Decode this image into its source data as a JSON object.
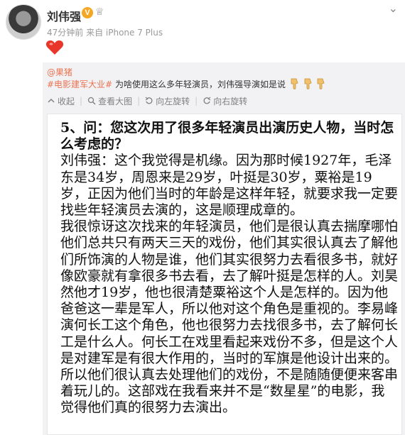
{
  "post": {
    "author": "刘伟强",
    "verified_badge": "V",
    "meta": "47分钟前 来自 iPhone 7 Plus",
    "more_icon": "chevron-down-icon",
    "reaction_icon": "heart-icon"
  },
  "repost": {
    "orig_author": "@果猪",
    "tag": "#电影建军大业#",
    "text": "为啥使用这么多年轻演员，刘伟强导演如是说",
    "toolbar": {
      "collapse": "收起",
      "view_large": "查看大图",
      "rotate_left": "向左旋转",
      "rotate_right": "向右旋转"
    }
  },
  "image": {
    "question": "5、问：您这次用了很多年轻演员出演历史人物，当时怎么考虑的？",
    "paragraphs": [
      "刘伟强：这个我觉得是机缘。因为那时候1927年，毛泽东是34岁，周恩来是29岁，叶挺是30岁，粟裕是19岁，正因为他们当时的年龄是这样年轻，就要求我一定要找些年轻演员去演的，这是顺理成章的。",
      "我很惊讶这次找来的年轻演员，他们是很认真去揣摩哪怕他们总共只有两天三天的戏份，他们其实很认真去了解他们所饰演的人物是谁，他们其实很努力去看很多书，就好像欧豪就有拿很多书去看，去了解叶挺是怎样的人。刘昊然他才19岁，他也很清楚粟裕这个人是怎样的。因为他爸爸这一辈是军人，所以他对这个角色是重视的。李易峰演何长工这个角色，他也很努力去找很多书，去了解何长工是什么人。何长工在戏里看起来戏份不多，但是这个人是对建军是有很大作用的，当时的军旗是他设计出来的。所以他们很认真去处理他们的戏份，不是随随便便来客串着玩儿的。这部戏在我看来并不是“数星星”的电影，我觉得他们真的很努力去演出。"
    ]
  }
}
